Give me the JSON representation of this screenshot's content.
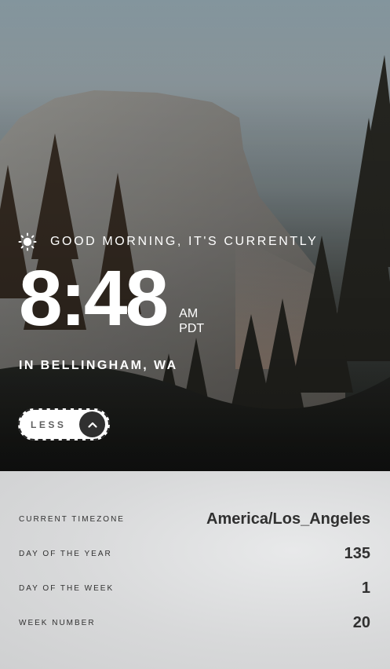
{
  "greeting": {
    "icon": "sun-icon",
    "text": "GOOD MORNING, IT'S CURRENTLY"
  },
  "clock": {
    "time": "8:48",
    "period": "AM",
    "timezone_abbr": "PDT"
  },
  "location": "IN BELLINGHAM, WA",
  "toggle": {
    "label": "LESS",
    "icon": "chevron-up-icon"
  },
  "details": [
    {
      "label": "CURRENT TIMEZONE",
      "value": "America/Los_Angeles"
    },
    {
      "label": "DAY OF THE YEAR",
      "value": "135"
    },
    {
      "label": "DAY OF THE WEEK",
      "value": "1"
    },
    {
      "label": "WEEK NUMBER",
      "value": "20"
    }
  ],
  "colors": {
    "text_light": "#ffffff",
    "text_dark": "#303030",
    "button_bg": "#ffffff",
    "chevron_bg": "#303030",
    "panel_bg": "#dcdcdc"
  }
}
